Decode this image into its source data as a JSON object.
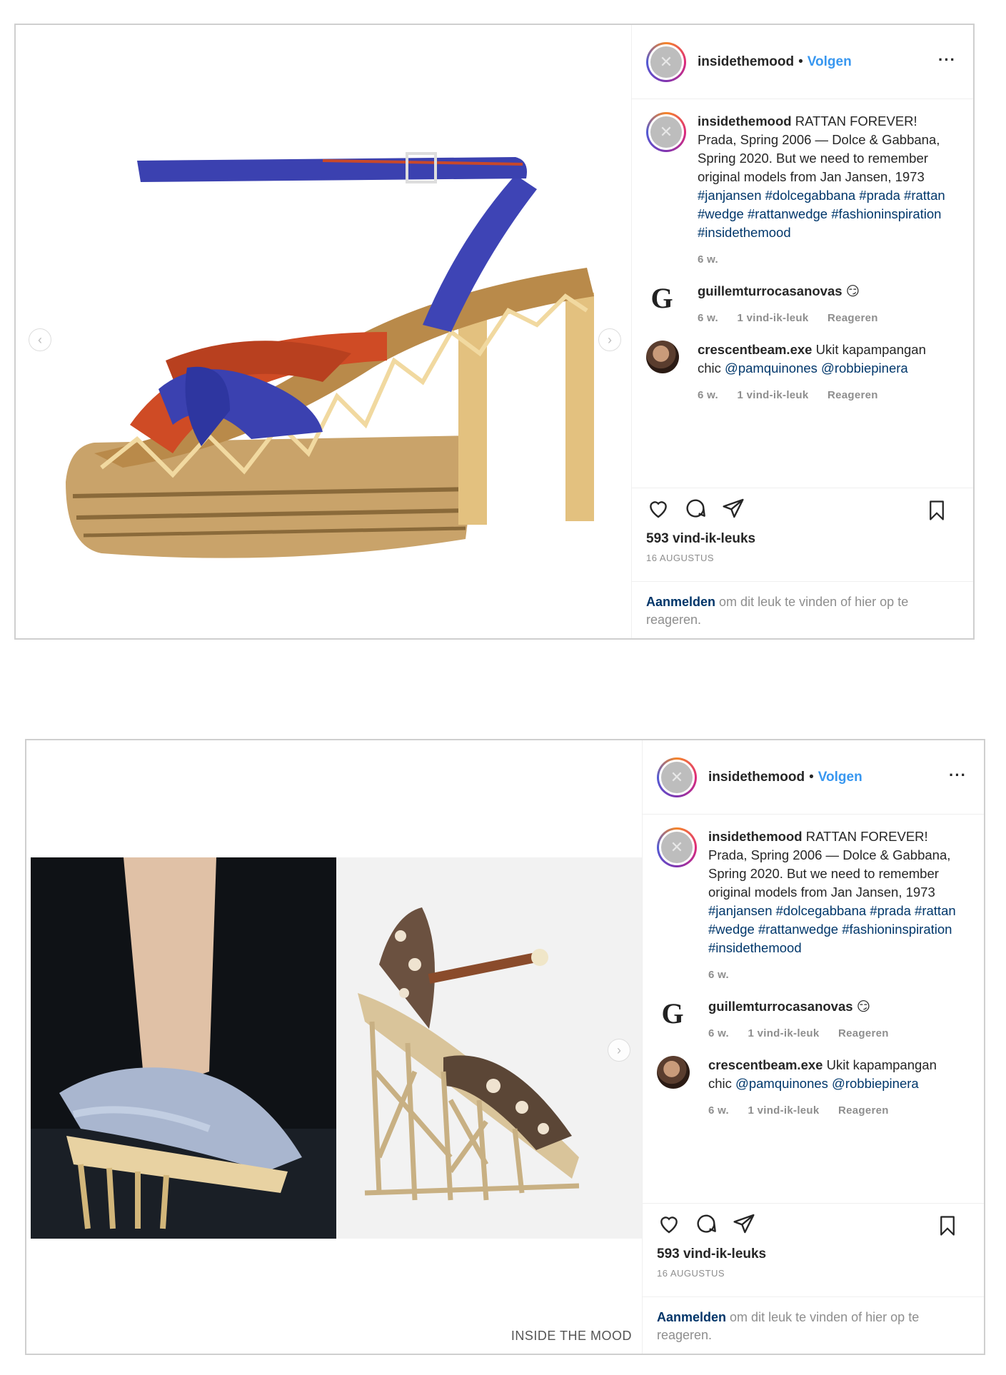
{
  "post": {
    "username": "insidethemood",
    "follow_label": "Volgen",
    "more_label": "···",
    "caption_text": "RATTAN FOREVER! Prada, Spring 2006 — Dolce & Gabbana, Spring 2020. But we need to remember original models from Jan Jansen, 1973",
    "hashtags": "#janjansen #dolcegabbana #prada #rattan #wedge #rattanwedge #fashioninspiration #insidethemood",
    "caption_time": "6 w.",
    "comments": [
      {
        "username": "guillemturrocasanovas",
        "text": "😏",
        "time": "6 w.",
        "likes": "1 vind-ik-leuk",
        "reply": "Reageren"
      },
      {
        "username": "crescentbeam.exe",
        "text": "Ukit kapampangan chic",
        "mentions": "@pamquinones @robbiepinera",
        "time": "6 w.",
        "likes": "1 vind-ik-leuk",
        "reply": "Reageren"
      }
    ],
    "likes_count": "593 vind-ik-leuks",
    "date": "16 AUGUSTUS",
    "login_link": "Aanmelden",
    "login_text": "om dit leuk te vinden of hier op te reageren."
  },
  "watermark": "INSIDE THE MOOD",
  "icons": {
    "heart": "heart-icon",
    "comment": "comment-icon",
    "share": "share-icon",
    "bookmark": "bookmark-icon",
    "prev": "chevron-left-icon",
    "next": "chevron-right-icon"
  }
}
